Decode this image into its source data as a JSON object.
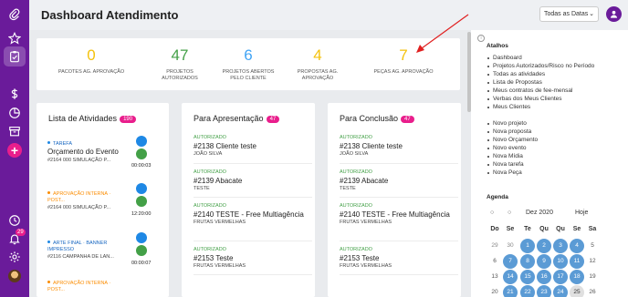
{
  "app": {
    "title": "Dashboard Atendimento",
    "date_filter": "Todas as Datas",
    "accent_color": "#6a1b9a",
    "badge_color": "#e91e8c"
  },
  "sidebar": {
    "icons": [
      "clip-icon",
      "star-icon",
      "clipboard-icon",
      "dollar-icon",
      "pie-chart-icon",
      "archive-icon",
      "plus-icon",
      "clock-icon",
      "bell-icon",
      "gear-icon",
      "avatar"
    ],
    "notification_count": "29"
  },
  "stats": [
    {
      "value": "0",
      "label": "PACOTES AG. APROVAÇÃO",
      "color": "#f4c20d"
    },
    {
      "value": "47",
      "label": "PROJETOS AUTORIZADOS",
      "color": "#43a047"
    },
    {
      "value": "6",
      "label": "PROJETOS ABERTOS PELO CLIENTE",
      "color": "#42a5f5"
    },
    {
      "value": "4",
      "label": "PROPOSTAS AG. APROVAÇÃO",
      "color": "#f4c20d"
    },
    {
      "value": "7",
      "label": "PEÇAS AG. APROVAÇÃO",
      "color": "#f4c20d"
    }
  ],
  "activities": {
    "title": "Lista de Atividades",
    "count": "190",
    "items": [
      {
        "tag": "TAREFA",
        "tag_color": "blue",
        "title": "Orçamento do Evento",
        "subtitle": "#2164 000 SIMULAÇÃO P...",
        "time": "00:00:03"
      },
      {
        "tag": "APROVAÇÃO INTERNA · POST...",
        "tag_color": "orange",
        "title": "",
        "subtitle": "#2164 000 SIMULAÇÃO P...",
        "time": "12:20:00"
      },
      {
        "tag": "ARTE FINAL · BANNER IMPRESSO",
        "tag_color": "blue",
        "title": "",
        "subtitle": "#2116 CAMPANHA DE LAN...",
        "time": "00:00:07"
      },
      {
        "tag": "APROVAÇÃO INTERNA · POST...",
        "tag_color": "orange",
        "title": "",
        "subtitle": "",
        "time": ""
      }
    ]
  },
  "presentation": {
    "title": "Para Apresentação",
    "count": "47",
    "items": [
      {
        "status": "AUTORIZADO",
        "title": "#2138 Cliente teste",
        "client": "JOÃO SILVA"
      },
      {
        "status": "AUTORIZADO",
        "title": "#2139 Abacate",
        "client": "TESTE"
      },
      {
        "status": "AUTORIZADO",
        "title": "#2140 TESTE - Free Multiagência",
        "client": "FRUTAS VERMELHAS"
      },
      {
        "status": "AUTORIZADO",
        "title": "#2153 Teste",
        "client": "FRUTAS VERMELHAS"
      }
    ]
  },
  "conclusion": {
    "title": "Para Conclusão",
    "count": "47",
    "items": [
      {
        "status": "AUTORIZADO",
        "title": "#2138 Cliente teste",
        "client": "JOÃO SILVA"
      },
      {
        "status": "AUTORIZADO",
        "title": "#2139 Abacate",
        "client": "TESTE"
      },
      {
        "status": "AUTORIZADO",
        "title": "#2140 TESTE - Free Multiagência",
        "client": "FRUTAS VERMELHAS"
      },
      {
        "status": "AUTORIZADO",
        "title": "#2153 Teste",
        "client": "FRUTAS VERMELHAS"
      }
    ]
  },
  "shortcuts": {
    "title": "Atalhos",
    "links": [
      "Dashboard",
      "Projetos Autorizados/Risco no Período",
      "Todas as atividades",
      "Lista de Propostas",
      "Meus contratos de fee-mensal",
      "Verbas dos Meus Clientes",
      "Meus Clientes"
    ],
    "new_items": [
      "Novo projeto",
      "Nova proposta",
      "Novo Orçamento",
      "Novo evento",
      "Nova Mídia",
      "Nova tarefa",
      "Nova Peça"
    ]
  },
  "calendar": {
    "title": "Agenda",
    "month": "Dez 2020",
    "today_label": "Hoje",
    "weekdays": [
      "Do",
      "Se",
      "Te",
      "Qu",
      "Qu",
      "Se",
      "Sa"
    ],
    "weeks": [
      [
        {
          "d": "29",
          "s": "muted"
        },
        {
          "d": "30",
          "s": "muted"
        },
        {
          "d": "1",
          "s": "active"
        },
        {
          "d": "2",
          "s": "active"
        },
        {
          "d": "3",
          "s": "active"
        },
        {
          "d": "4",
          "s": "active"
        },
        {
          "d": "5",
          "s": "plain"
        }
      ],
      [
        {
          "d": "6",
          "s": "plain"
        },
        {
          "d": "7",
          "s": "active"
        },
        {
          "d": "8",
          "s": "active"
        },
        {
          "d": "9",
          "s": "active"
        },
        {
          "d": "10",
          "s": "active"
        },
        {
          "d": "11",
          "s": "active"
        },
        {
          "d": "12",
          "s": "plain"
        }
      ],
      [
        {
          "d": "13",
          "s": "plain"
        },
        {
          "d": "14",
          "s": "active"
        },
        {
          "d": "15",
          "s": "active"
        },
        {
          "d": "16",
          "s": "active"
        },
        {
          "d": "17",
          "s": "active"
        },
        {
          "d": "18",
          "s": "active"
        },
        {
          "d": "19",
          "s": "plain"
        }
      ],
      [
        {
          "d": "20",
          "s": "plain"
        },
        {
          "d": "21",
          "s": "active"
        },
        {
          "d": "22",
          "s": "active"
        },
        {
          "d": "23",
          "s": "active"
        },
        {
          "d": "24",
          "s": "active"
        },
        {
          "d": "25",
          "s": "today"
        },
        {
          "d": "26",
          "s": "plain"
        }
      ]
    ]
  }
}
